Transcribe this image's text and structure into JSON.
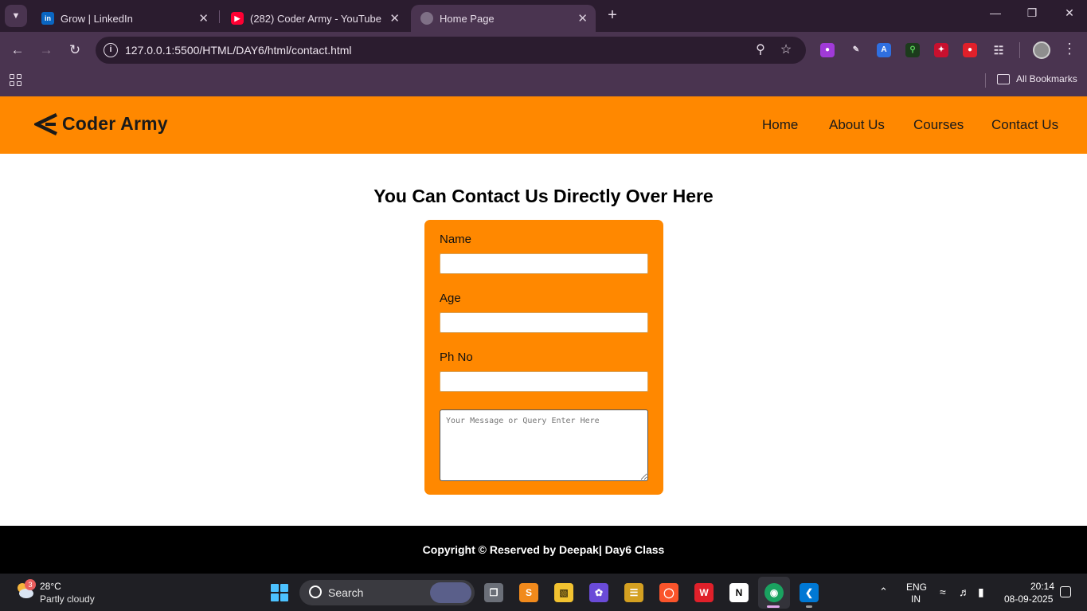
{
  "browser": {
    "tabs": [
      {
        "title": "Grow | LinkedIn",
        "favicon": "linkedin-icon",
        "active": false
      },
      {
        "title": "(282) Coder Army - YouTube",
        "favicon": "youtube-icon",
        "active": false
      },
      {
        "title": "Home Page",
        "favicon": "globe-icon",
        "active": true
      }
    ],
    "url": "127.0.0.1:5500/HTML/DAY6/html/contact.html",
    "bookmarks_label": "All Bookmarks"
  },
  "site": {
    "brand": "Coder Army",
    "nav": [
      "Home",
      "About Us",
      "Courses",
      "Contact Us"
    ],
    "heading": "You Can Contact Us Directly Over Here",
    "form": {
      "fields": [
        {
          "label": "Name",
          "value": ""
        },
        {
          "label": "Age",
          "value": ""
        },
        {
          "label": "Ph No",
          "value": ""
        }
      ],
      "message_placeholder": "Your Message or Query Enter Here"
    },
    "footer": "Copyright © Reserved by Deepak| Day6 Class",
    "colors": {
      "accent": "#ff8800",
      "footer_bg": "#000000"
    }
  },
  "taskbar": {
    "weather": {
      "temp": "28°C",
      "condition": "Partly cloudy",
      "badge": "3"
    },
    "search_label": "Search",
    "lang_top": "ENG",
    "lang_bottom": "IN",
    "time": "20:14",
    "date": "08-09-2025"
  }
}
